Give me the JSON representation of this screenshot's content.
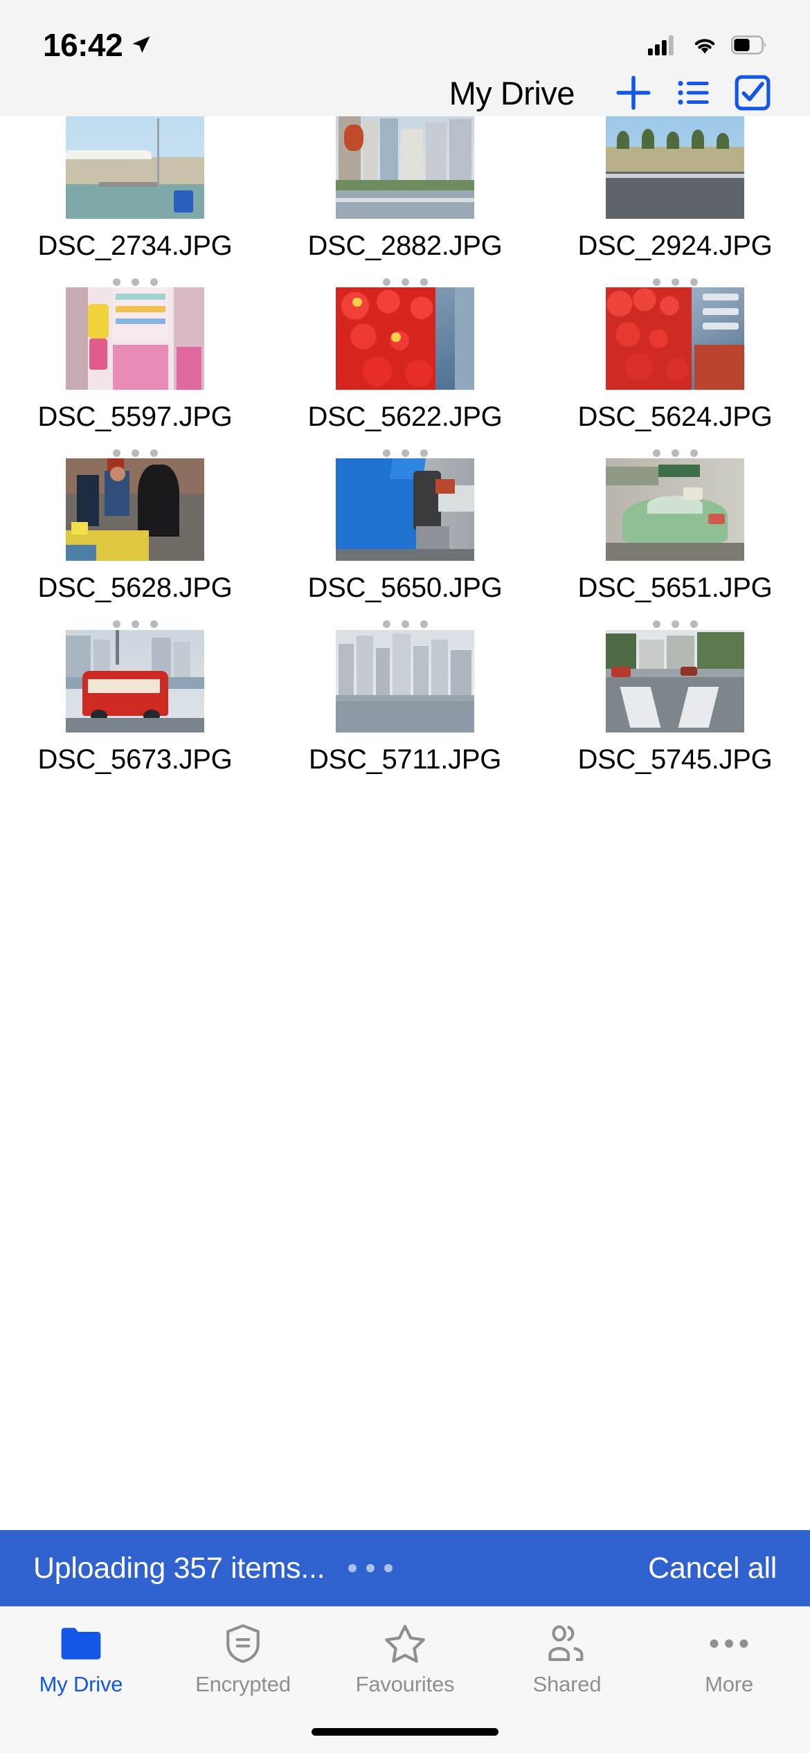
{
  "status_bar": {
    "time": "16:42",
    "location_icon": "location-arrow-icon",
    "cellular_icon": "cellular-signal-icon",
    "wifi_icon": "wifi-icon",
    "battery_icon": "battery-icon"
  },
  "nav_bar": {
    "title": "My Drive",
    "add_icon": "plus-icon",
    "list_icon": "list-view-icon",
    "select_icon": "checkbox-select-icon",
    "accent_color": "#1357e8"
  },
  "files": [
    {
      "name": "DSC_2734.JPG",
      "art": "marina"
    },
    {
      "name": "DSC_2882.JPG",
      "art": "city-street"
    },
    {
      "name": "DSC_2924.JPG",
      "art": "palm-road"
    },
    {
      "name": "DSC_5597.JPG",
      "art": "shop-interior"
    },
    {
      "name": "DSC_5622.JPG",
      "art": "lanterns-a"
    },
    {
      "name": "DSC_5624.JPG",
      "art": "lanterns-b"
    },
    {
      "name": "DSC_5628.JPG",
      "art": "market-crowd"
    },
    {
      "name": "DSC_5650.JPG",
      "art": "blue-truck"
    },
    {
      "name": "DSC_5651.JPG",
      "art": "green-taxi"
    },
    {
      "name": "DSC_5673.JPG",
      "art": "red-bus"
    },
    {
      "name": "DSC_5711.JPG",
      "art": "skyline-river"
    },
    {
      "name": "DSC_5745.JPG",
      "art": "street-crossing"
    }
  ],
  "upload_banner": {
    "text": "Uploading 357 items...",
    "cancel_label": "Cancel all",
    "background_color": "#2f62ce",
    "progress_dots": "loading-dots"
  },
  "tab_bar": {
    "items": [
      {
        "label": "My Drive",
        "icon": "folder-icon",
        "active": true
      },
      {
        "label": "Encrypted",
        "icon": "shield-icon",
        "active": false
      },
      {
        "label": "Favourites",
        "icon": "star-icon",
        "active": false
      },
      {
        "label": "Shared",
        "icon": "people-icon",
        "active": false
      },
      {
        "label": "More",
        "icon": "ellipsis-icon",
        "active": false
      }
    ],
    "active_color": "#1357e8",
    "inactive_color": "#8e8e93"
  }
}
